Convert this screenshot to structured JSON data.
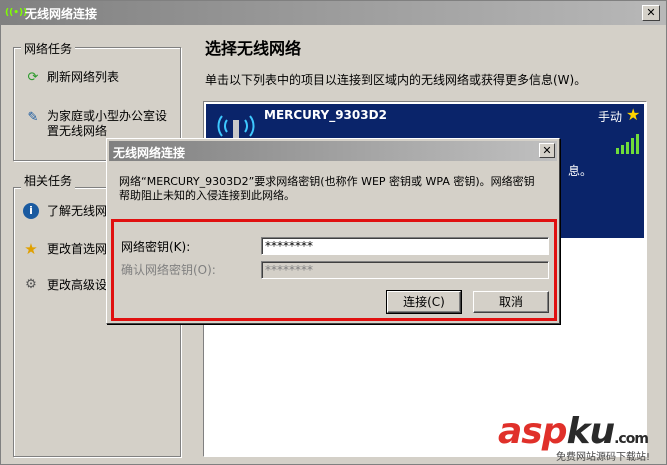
{
  "window": {
    "title": "无线网络连接",
    "close_label": "✕"
  },
  "left": {
    "network_tasks": {
      "title": "网络任务",
      "items": [
        {
          "label": "刷新网络列表"
        },
        {
          "label_line1": "为家庭或小型办公室设",
          "label_line2": "置无线网络"
        }
      ]
    },
    "related_tasks": {
      "title": "相关任务",
      "items": [
        {
          "label": "了解无线网"
        },
        {
          "label": "更改首选网"
        },
        {
          "label": "更改高级设"
        }
      ]
    }
  },
  "right": {
    "heading": "选择无线网络",
    "description": "单击以下列表中的项目以连接到区域内的无线网络或获得更多信息(W)。",
    "network": {
      "ssid": "MERCURY_9303D2",
      "mode": "手动",
      "info_fragment": "息。"
    }
  },
  "dialog": {
    "title": "无线网络连接",
    "close_label": "✕",
    "message_line1": "网络“MERCURY_9303D2”要求网络密钥(也称作 WEP 密钥或 WPA 密钥)。网络密钥",
    "message_line2": "帮助阻止未知的入侵连接到此网络。",
    "key_label": "网络密钥(K):",
    "key_value": "********",
    "confirm_label": "确认网络密钥(O):",
    "confirm_value": "********",
    "connect_label": "连接(C)",
    "cancel_label": "取消"
  },
  "watermark": {
    "part1": "asp",
    "part2": "ku",
    "suffix": ".com",
    "sub": "免费网站源码下载站!"
  },
  "colors": {
    "selection": "#0a246a",
    "highlight_box": "#e01010"
  }
}
